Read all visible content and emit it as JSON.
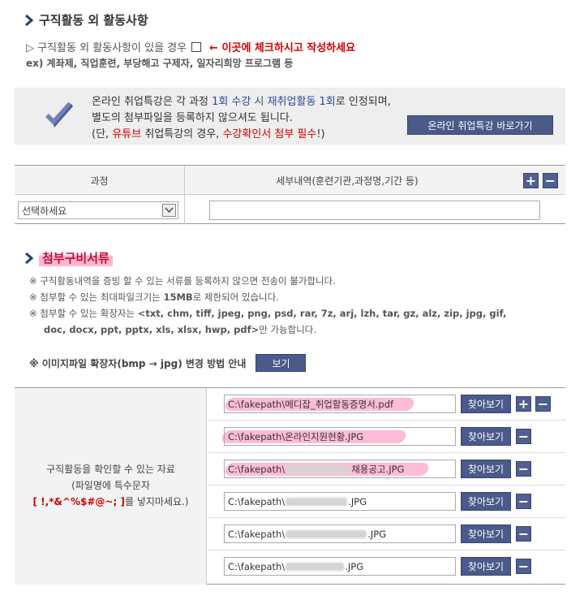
{
  "section1": {
    "title": "구직활동 외 활동사항",
    "line1_prefix": "▷ 구직활동 외 활동사항이 있을 경우",
    "line1_instruction": "← 이곳에 체크하시고 작성하세요",
    "line2": "ex) 계좌제, 직업훈련, 부당해고 구제자, 일자리희망 프로그램 등"
  },
  "notice": {
    "line1_a": "온라인 취업특강은 각 과정 ",
    "line1_b": "1회 수강 시 재취업활동 1회",
    "line1_c": "로 인정되며,",
    "line2": "별도의 첨부파일을 등록하지 않으셔도 됩니다.",
    "line3_a": "(단, ",
    "line3_b": "유튜브",
    "line3_c": " 취업특강의 경우, ",
    "line3_d": "수강확인서 첨부 필수",
    "line3_e": "!)",
    "button": "온라인 취업특강 바로가기"
  },
  "course_table": {
    "col_course": "과정",
    "col_detail": "세부내역(훈련기관,과정명,기간 등)",
    "select_value": "선택하세요",
    "detail_value": "",
    "add": "+",
    "remove": "−"
  },
  "section2": {
    "title": "첨부구비서류",
    "notes": [
      "※ 구직활동내역을 증빙 할 수 있는 서류를 등록하지 않으면 전송이 불가합니다.",
      "※ 첨부할 수 있는 최대파일크기는 ",
      "15MB",
      "로 제한되어 있습니다.",
      "※ 첨부할 수 있는 확장자는 ",
      "<txt, chm, tiff, jpeg, png, psd, rar, 7z, arj, lzh, tar, gz, alz, zip, jpg, gif,",
      "doc, docx, ppt, pptx, xls, xlsx, hwp, pdf>",
      "만 가능합니다."
    ],
    "convert_label": "※ 이미지파일 확장자(bmp → jpg) 변경 방법 안내",
    "convert_button": "보기"
  },
  "files": {
    "label1": "구직활동을 확인할 수 있는 자료",
    "label2": "(파일명에 특수문자",
    "label3a": "[ !,*&^%$#@~; ]",
    "label3b": "를 넣지마세요.)",
    "browse": "찾아보기",
    "plus": "+",
    "minus": "−",
    "rows": [
      {
        "prefix": "C:\\fakepath\\메디잡_취업활동증명서.pdf",
        "suffix": ""
      },
      {
        "prefix": "C:\\fakepath\\온라인지원현황.JPG",
        "suffix": ""
      },
      {
        "prefix": "C:\\fakepath\\",
        "suffix": "채용공고.JPG"
      },
      {
        "prefix": "C:\\fakepath\\",
        "suffix": ".JPG"
      },
      {
        "prefix": "C:\\fakepath\\",
        "suffix": ".JPG"
      },
      {
        "prefix": "C:\\fakepath\\",
        "suffix": ".JPG"
      }
    ]
  },
  "colors": {
    "accent": "#4a5a8a",
    "red": "#d40000",
    "blue": "#2a4a9a",
    "highlight": "#ffa0c8"
  }
}
